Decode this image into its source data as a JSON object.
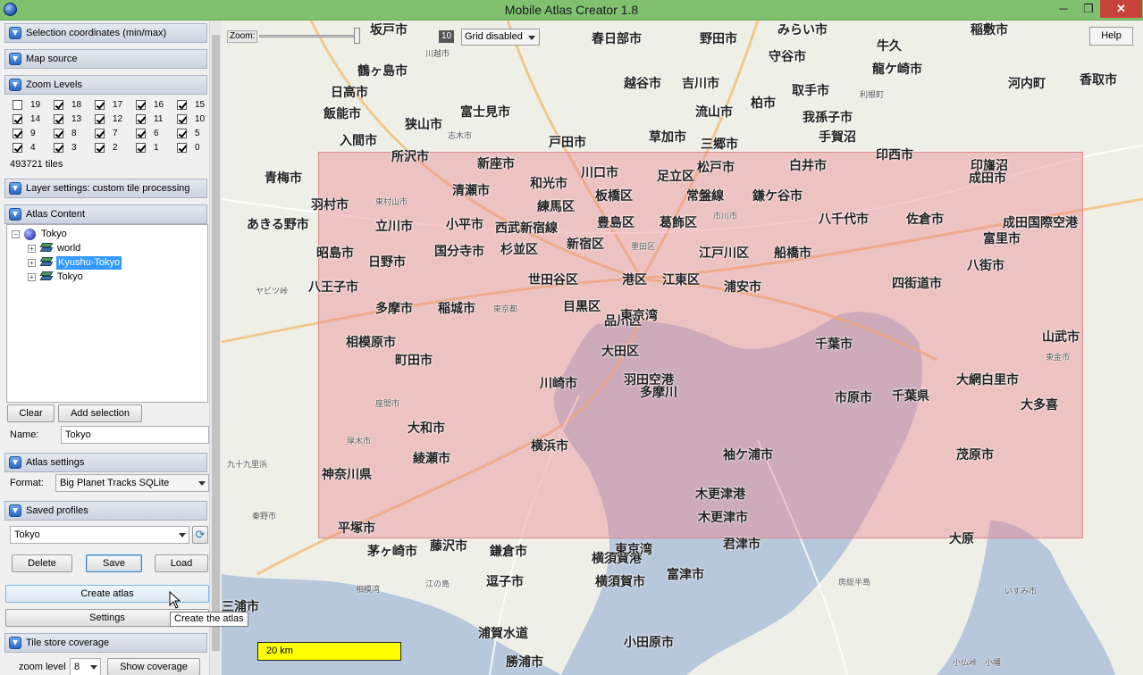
{
  "window": {
    "title": "Mobile Atlas Creator 1.8",
    "min": "─",
    "max": "❐",
    "close": "✕"
  },
  "sections": {
    "selection": "Selection coordinates (min/max)",
    "map_source": "Map source",
    "zoom_levels": "Zoom Levels",
    "layer_settings": "Layer settings: custom tile processing",
    "atlas_content": "Atlas Content",
    "atlas_settings": "Atlas settings",
    "saved_profiles": "Saved profiles",
    "tile_store": "Tile store coverage"
  },
  "zoom_levels": [
    {
      "level": "19",
      "checked": false
    },
    {
      "level": "18",
      "checked": true
    },
    {
      "level": "17",
      "checked": true
    },
    {
      "level": "16",
      "checked": true
    },
    {
      "level": "15",
      "checked": true
    },
    {
      "level": "14",
      "checked": true
    },
    {
      "level": "13",
      "checked": true
    },
    {
      "level": "12",
      "checked": true
    },
    {
      "level": "11",
      "checked": true
    },
    {
      "level": "10",
      "checked": true
    },
    {
      "level": "9",
      "checked": true
    },
    {
      "level": "8",
      "checked": true
    },
    {
      "level": "7",
      "checked": true
    },
    {
      "level": "6",
      "checked": true
    },
    {
      "level": "5",
      "checked": true
    },
    {
      "level": "4",
      "checked": true
    },
    {
      "level": "3",
      "checked": true
    },
    {
      "level": "2",
      "checked": true
    },
    {
      "level": "1",
      "checked": true
    },
    {
      "level": "0",
      "checked": true
    }
  ],
  "tile_count": "493721 tiles",
  "atlas_tree": {
    "root": "Tokyo",
    "children": [
      "world",
      "Kyushu-Tokyo",
      "Tokyo"
    ],
    "selected": "Kyushu-Tokyo"
  },
  "atlas_buttons": {
    "clear": "Clear",
    "add_selection": "Add selection"
  },
  "atlas_name": {
    "label": "Name:",
    "value": "Tokyo"
  },
  "atlas_format": {
    "label": "Format:",
    "value": "Big Planet Tracks SQLite"
  },
  "profiles": {
    "selected": "Tokyo",
    "delete": "Delete",
    "save": "Save",
    "load": "Load"
  },
  "actions": {
    "create_atlas": "Create atlas",
    "settings": "Settings",
    "tooltip": "Create the atlas"
  },
  "tile_store": {
    "zoom_label": "zoom level",
    "zoom_value": "8",
    "show_coverage": "Show coverage"
  },
  "map_controls": {
    "zoom_label": "Zoom:",
    "zoom_value": "10",
    "grid": "Grid disabled",
    "help": "Help",
    "scale": "20 km"
  },
  "map_labels": [
    "坂戸市",
    "春日部市",
    "野田市",
    "みらい市",
    "稲敷市",
    "牛久",
    "鶴ヶ島市",
    "川越市",
    "越谷市",
    "吉川市",
    "守谷市",
    "龍ケ崎市",
    "日高市",
    "富士見市",
    "流山市",
    "柏市",
    "取手市",
    "利根町",
    "河内町",
    "香取市",
    "飯能市",
    "狭山市",
    "志木市",
    "戸田市",
    "草加市",
    "三郷市",
    "我孫子市",
    "手賀沼",
    "成田市",
    "入間市",
    "所沢市",
    "新座市",
    "川口市",
    "足立区",
    "松戸市",
    "白井市",
    "印西市",
    "印旛沼",
    "青梅市",
    "清瀬市",
    "和光市",
    "板橋区",
    "常盤線",
    "鎌ケ谷市",
    "羽村市",
    "東村山市",
    "練馬区",
    "豊島区",
    "葛飾区",
    "市川市",
    "八千代市",
    "佐倉市",
    "成田国際空港",
    "あきる野市",
    "立川市",
    "小平市",
    "西武新宿線",
    "新宿区",
    "墨田区",
    "富里市",
    "昭島市",
    "国分寺市",
    "杉並区",
    "江戸川区",
    "船橋市",
    "八街市",
    "日野市",
    "世田谷区",
    "港区",
    "江東区",
    "浦安市",
    "四街道市",
    "八王子市",
    "多摩市",
    "稲城市",
    "東京都",
    "目黒区",
    "品川区",
    "東京湾",
    "千葉市",
    "山武市",
    "相模原市",
    "町田市",
    "大田区",
    "東金市",
    "大網白里市",
    "川崎市",
    "羽田空港",
    "多摩川",
    "市原市",
    "千葉県",
    "座間市",
    "大和市",
    "横浜市",
    "厚木市",
    "綾瀬市",
    "袖ケ浦市",
    "茂原市",
    "神奈川県",
    "木更津港",
    "木更津市",
    "秦野市",
    "平塚市",
    "君津市",
    "茅ヶ崎市",
    "藤沢市",
    "鎌倉市",
    "横須賀港",
    "東京湾",
    "富津市",
    "逗子市",
    "横須賀市",
    "江の島",
    "房総半島",
    "いすみ市",
    "相模湾",
    "浦賀水道",
    "小田原市",
    "三浦市",
    "勝浦市",
    "小仏峠",
    "ヤビツ峠",
    "九十九里浜",
    "大多喜",
    "大原",
    "小幡"
  ],
  "colors": {
    "titlebar": "#7fc16f",
    "selection": "#eb828c",
    "water": "#b7c8dd",
    "land": "#eef0e8",
    "scalebar": "#ffff00",
    "tree_selected": "#3399ff"
  }
}
